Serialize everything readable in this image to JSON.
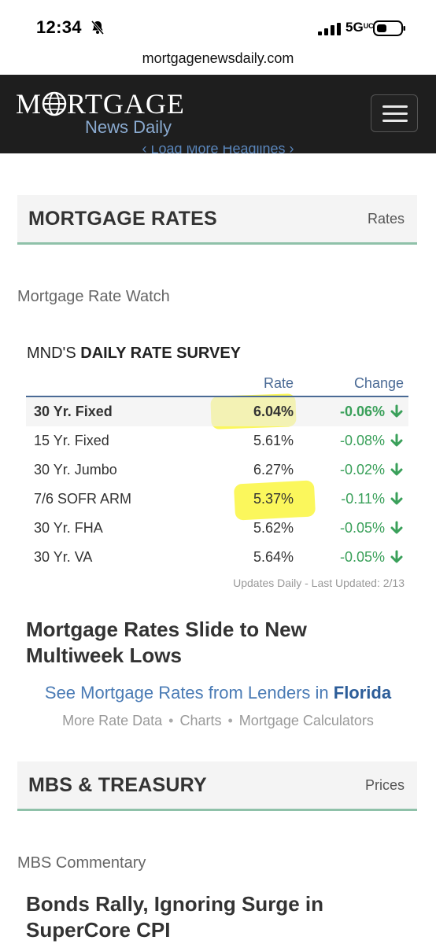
{
  "status_bar": {
    "time": "12:34",
    "network": "5G",
    "network_suffix": "UC"
  },
  "browser": {
    "url": "mortgagenewsdaily.com"
  },
  "header": {
    "logo_left": "M",
    "logo_right": "RTGAGE",
    "logo_sub": "News Daily"
  },
  "load_more": "Load More Headlines",
  "rates_section": {
    "title": "MORTGAGE RATES",
    "link": "Rates",
    "sub_label": "Mortgage Rate Watch"
  },
  "survey": {
    "prefix": "MND'S ",
    "title": "DAILY RATE SURVEY",
    "col_rate": "Rate",
    "col_change": "Change",
    "rows": [
      {
        "product": "30 Yr. Fixed",
        "rate": "6.04%",
        "change": "-0.06%"
      },
      {
        "product": "15 Yr. Fixed",
        "rate": "5.61%",
        "change": "-0.08%"
      },
      {
        "product": "30 Yr. Jumbo",
        "rate": "6.27%",
        "change": "-0.02%"
      },
      {
        "product": "7/6 SOFR ARM",
        "rate": "5.37%",
        "change": "-0.11%"
      },
      {
        "product": "30 Yr. FHA",
        "rate": "5.62%",
        "change": "-0.05%"
      },
      {
        "product": "30 Yr. VA",
        "rate": "5.64%",
        "change": "-0.05%"
      }
    ],
    "updated": "Updates Daily - Last Updated: 2/13"
  },
  "article1": {
    "line1": "Mortgage Rates Slide to New",
    "line2": "Multiweek Lows"
  },
  "cta": {
    "text": "See Mortgage Rates from Lenders in ",
    "state": "Florida"
  },
  "links": {
    "rate_data": "More Rate Data",
    "charts": "Charts",
    "calculators": "Mortgage Calculators",
    "separator": "•"
  },
  "mbs_section": {
    "title": "MBS & TREASURY",
    "link": "Prices",
    "sub_label": "MBS Commentary"
  },
  "article2": {
    "line1": "Bonds Rally, Ignoring Surge in",
    "line2": "SuperCore CPI"
  },
  "colors": {
    "header_bg": "#1e1e1e",
    "accent_green": "#8fc1a9",
    "change_green": "#3aa05a",
    "link_blue": "#4a7bb5",
    "highlight": "#fbf64a"
  }
}
